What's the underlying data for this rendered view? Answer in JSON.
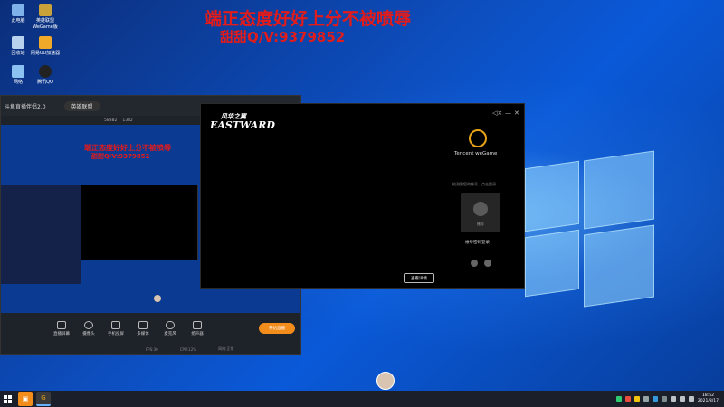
{
  "overlay": {
    "line1": "端正态度好好上分不被喷辱",
    "line2": "甜甜Q/V:9379852"
  },
  "desktop_icons": [
    {
      "label": "此电脑"
    },
    {
      "label": "英雄联盟WeGame版"
    },
    {
      "label": "回收站"
    },
    {
      "label": "网易UU加速器"
    },
    {
      "label": "网络"
    },
    {
      "label": "腾讯QQ"
    }
  ],
  "stream_app": {
    "title": "斗鱼直播伴侣2.0",
    "tab_title": "英雄联盟",
    "stat_fans": "58382",
    "stat_heat": "1382",
    "tools": [
      {
        "label": "直播屏幕",
        "icon": "monitor-icon"
      },
      {
        "label": "摄像头",
        "icon": "camera-icon"
      },
      {
        "label": "手机投屏",
        "icon": "phone-icon"
      },
      {
        "label": "多媒体",
        "icon": "play-icon"
      },
      {
        "label": "麦克风",
        "icon": "mic-icon"
      },
      {
        "label": "扬声器",
        "icon": "speaker-icon"
      }
    ],
    "start_live_label": "开始直播",
    "status": {
      "fps": "FPS:30",
      "cpu": "CPU:12%",
      "net": "网络:正常"
    },
    "overlay_line1": "端正态度好好上分不被喷辱",
    "overlay_line2": "甜甜Q/V:9379852"
  },
  "streamer_logo": {
    "line1": "风华之翼",
    "line2": "EASTWARD"
  },
  "wegame": {
    "brand": "Tencent weGame",
    "hint": "检测到您的帐号，点击登录",
    "avatar_label": "账号",
    "login_link": "帐号密码登录",
    "view_details_label": "查看详情"
  },
  "taskbar": {
    "time": "18:52",
    "date": "2021/8/17"
  },
  "colors": {
    "overlay_red": "#e21b1b",
    "start_live_orange": "#f28c1b",
    "wegame_gold": "#e8a317"
  }
}
